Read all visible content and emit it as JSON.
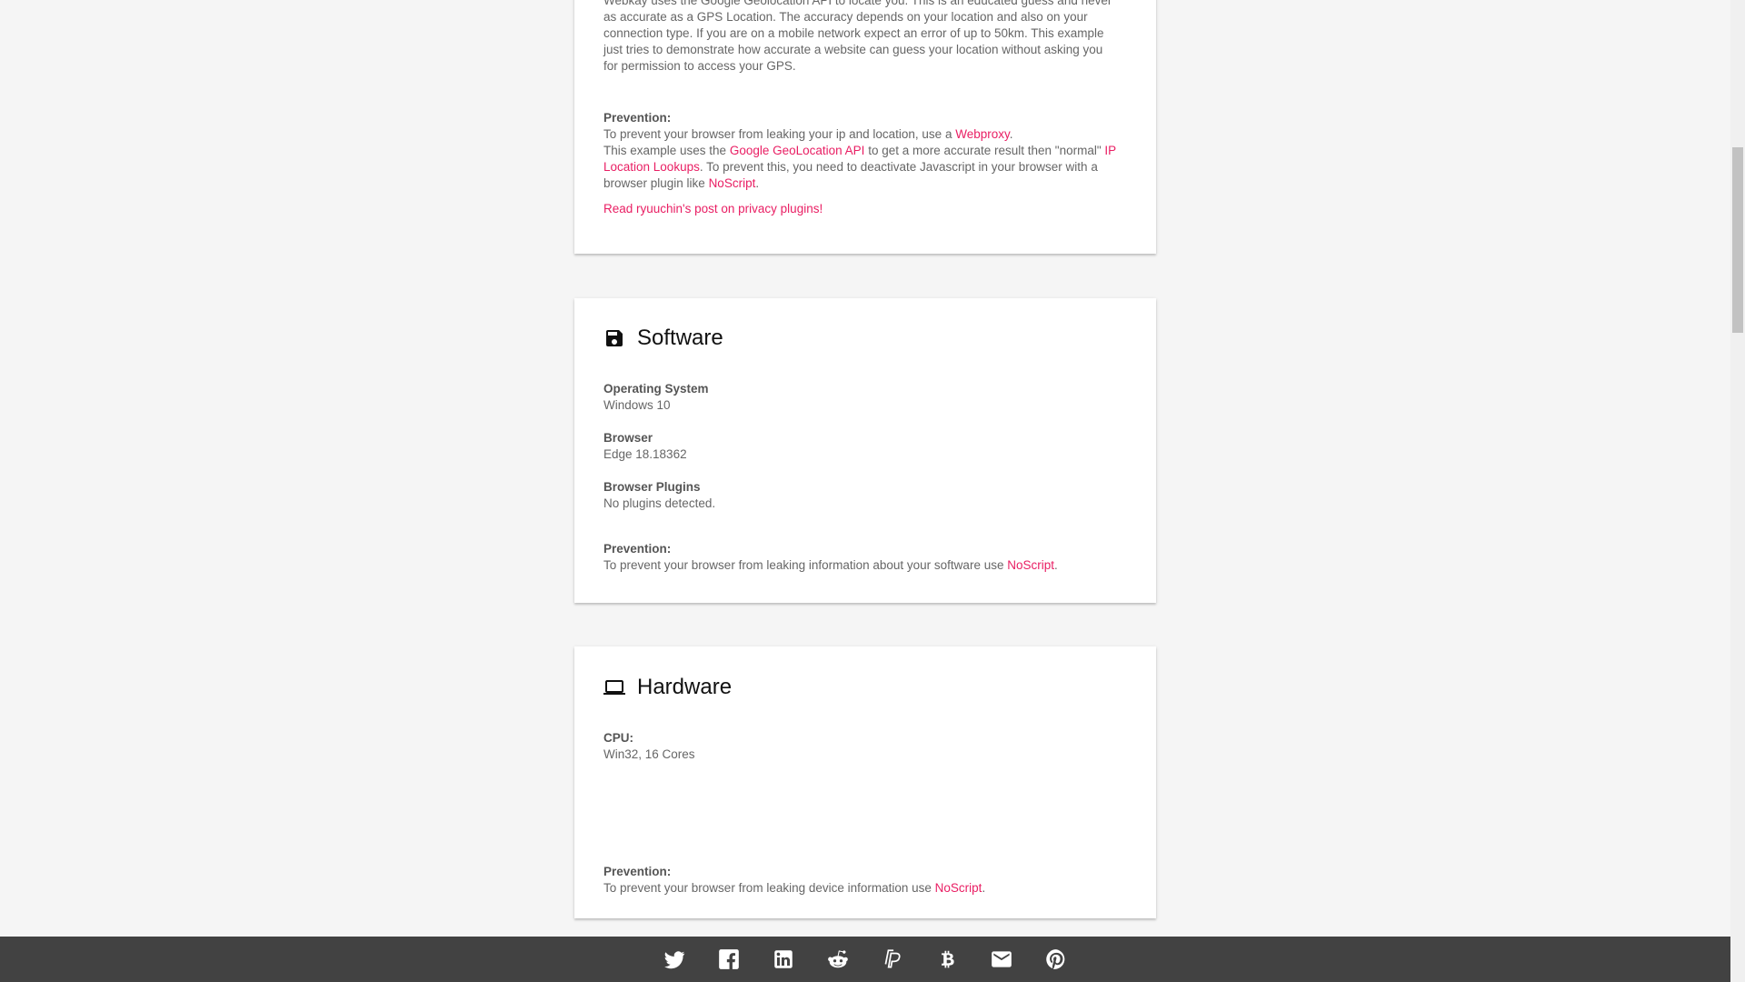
{
  "location_card": {
    "intro": "Webkay uses the Google Geolocation API to locate you. This is an educated guess and never as accurate as a GPS Location. The accuracy depends on your location and also on your connection type. If you are on a mobile network expect an error of up to 50km. This example just tries to demonstrate how accurate a website can guess your location without asking you for permission to access your GPS.",
    "prevention_label": "Prevention:",
    "line1_text": "To prevent your browser from leaking your ip and location, use a ",
    "line1_link": "Webproxy",
    "line1_end": ".",
    "line2_text": "This example uses the ",
    "line2_link1": "Google GeoLocation API",
    "line2_mid": " to get a more accurate result then \"normal\" ",
    "line2_link2": "IP Location Lookups",
    "line2_mid2": ". To prevent this, you need to deactivate Javascript in your browser with a browser plugin like ",
    "line2_link3": "NoScript",
    "line2_end": ".",
    "read_link": "Read ryuuchin's post on privacy plugins!"
  },
  "software_card": {
    "title": "Software",
    "icon": "floppy-disk-icon",
    "fields": [
      {
        "label": "Operating System",
        "value": "Windows 10"
      },
      {
        "label": "Browser",
        "value": "Edge 18.18362"
      },
      {
        "label": "Browser Plugins",
        "value": "No plugins detected."
      }
    ],
    "prevention_label": "Prevention:",
    "prevention_text": "To prevent your browser from leaking information about your software use ",
    "prevention_link": "NoScript",
    "prevention_end": "."
  },
  "hardware_card": {
    "title": "Hardware",
    "icon": "laptop-icon",
    "fields": [
      {
        "label": "CPU:",
        "value": "Win32, 16 Cores"
      }
    ],
    "prevention_label": "Prevention:",
    "prevention_text": "To prevent your browser from leaking device information use ",
    "prevention_link": "NoScript",
    "prevention_end": "."
  },
  "footer": {
    "icons": [
      "twitter-icon",
      "facebook-icon",
      "linkedin-icon",
      "reddit-icon",
      "paypal-icon",
      "bitcoin-icon",
      "email-icon",
      "pinterest-icon"
    ]
  },
  "colors": {
    "accent": "#e91e63",
    "footer_bg": "#424242",
    "page_bg": "#f5f5f5"
  }
}
